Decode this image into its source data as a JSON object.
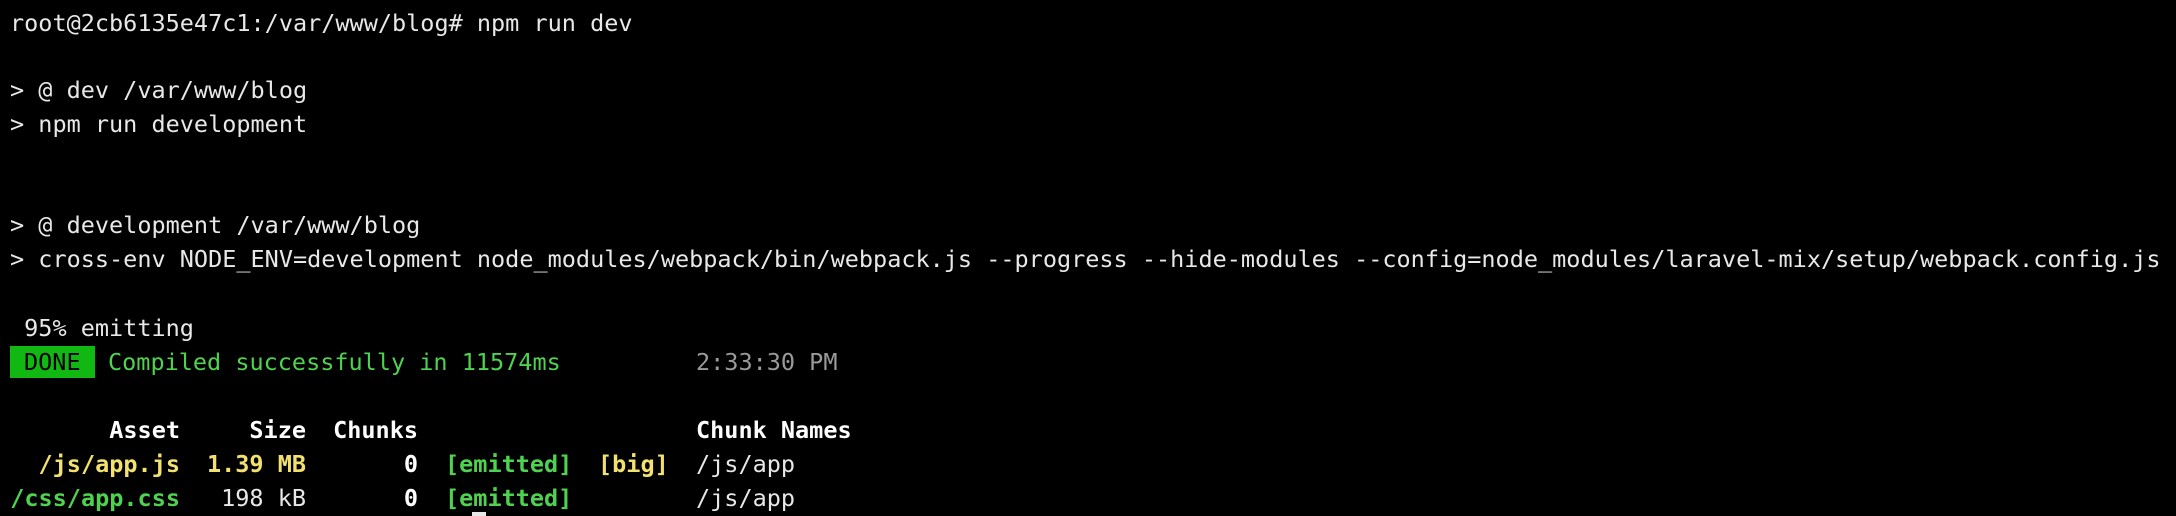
{
  "terminal": {
    "lines": {
      "prompt": "root@2cb6135e47c1:/var/www/blog# npm run dev",
      "script1_header": "> @ dev /var/www/blog",
      "script1_cmd": "> npm run development",
      "script2_header": "> @ development /var/www/blog",
      "script2_cmd": "> cross-env NODE_ENV=development node_modules/webpack/bin/webpack.js --progress --hide-modules --config=node_modules/laravel-mix/setup/webpack.config.js",
      "progress": " 95% emitting"
    },
    "status": {
      "badge": "DONE",
      "message": "Compiled successfully in 11574ms",
      "time": "2:33:30 PM"
    },
    "asset_table": {
      "headers": {
        "asset": "Asset",
        "size": "Size",
        "chunks": "Chunks",
        "chunk_names": "Chunk Names"
      },
      "rows": [
        {
          "asset": "/js/app.js",
          "size": "1.39 MB",
          "chunks": "0",
          "emitted": "[emitted]",
          "flag": "[big]",
          "chunk_names": "/js/app"
        },
        {
          "asset": "/css/app.css",
          "size": "198 kB",
          "chunks": "0",
          "emitted": "[emitted]",
          "flag": "",
          "chunk_names": "/js/app"
        }
      ]
    },
    "colors": {
      "background": "#000000",
      "text": "#e8e8e8",
      "success_green": "#4fd24f",
      "badge_green": "#11b811",
      "warning_yellow": "#f2e06f"
    }
  }
}
